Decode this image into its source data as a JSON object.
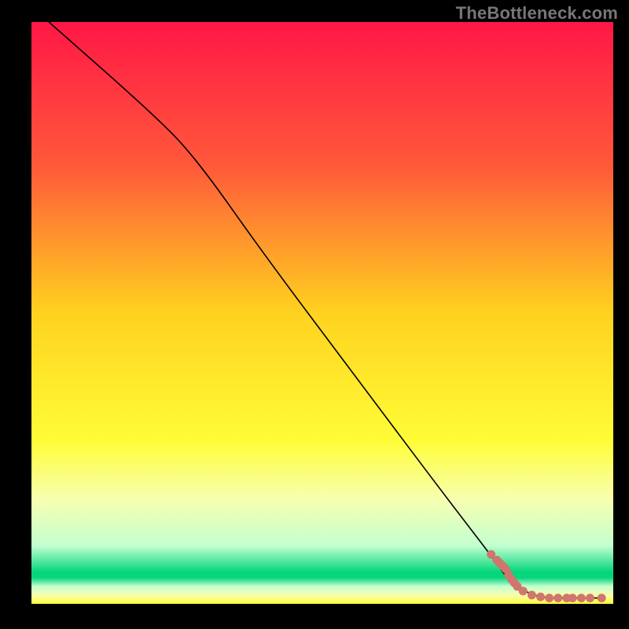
{
  "watermark": "TheBottleneck.com",
  "chart_data": {
    "type": "line",
    "title": "",
    "xlabel": "",
    "ylabel": "",
    "xlim": [
      0,
      100
    ],
    "ylim": [
      0,
      100
    ],
    "grid": false,
    "legend": false,
    "series": [
      {
        "name": "curve",
        "style": "line",
        "color": "#000000",
        "x": [
          3,
          20,
          28,
          40,
          55,
          70,
          80,
          82,
          85,
          88,
          93,
          98
        ],
        "y": [
          100,
          85,
          77,
          60,
          40,
          20,
          7,
          4,
          2,
          1,
          1,
          1
        ]
      },
      {
        "name": "highlight-points",
        "style": "scatter",
        "color": "#d1766c",
        "x": [
          79,
          80,
          80.5,
          81,
          81.5,
          82,
          82.5,
          83,
          83.5,
          84.5,
          86,
          87.5,
          89,
          90.5,
          92,
          93,
          94.5,
          96,
          98
        ],
        "y": [
          8.5,
          7.5,
          7,
          6.5,
          6,
          5,
          4.2,
          3.6,
          3.0,
          2.2,
          1.5,
          1.2,
          1.0,
          1.0,
          1.0,
          1.0,
          1.0,
          1.0,
          1.0
        ]
      }
    ],
    "background_gradient": {
      "type": "vertical-mirrored",
      "stops": [
        {
          "pos": 0.0,
          "color": "#ff1746"
        },
        {
          "pos": 0.25,
          "color": "#ff5a3a"
        },
        {
          "pos": 0.5,
          "color": "#ffd21f"
        },
        {
          "pos": 0.72,
          "color": "#fffd37"
        },
        {
          "pos": 0.82,
          "color": "#f7ffb0"
        },
        {
          "pos": 0.9,
          "color": "#c4ffd0"
        },
        {
          "pos": 0.945,
          "color": "#05d67c"
        },
        {
          "pos": 0.955,
          "color": "#05d67c"
        },
        {
          "pos": 0.97,
          "color": "#c4ffd0"
        },
        {
          "pos": 0.985,
          "color": "#f7ffb0"
        },
        {
          "pos": 1.0,
          "color": "#fffd37"
        }
      ]
    }
  }
}
